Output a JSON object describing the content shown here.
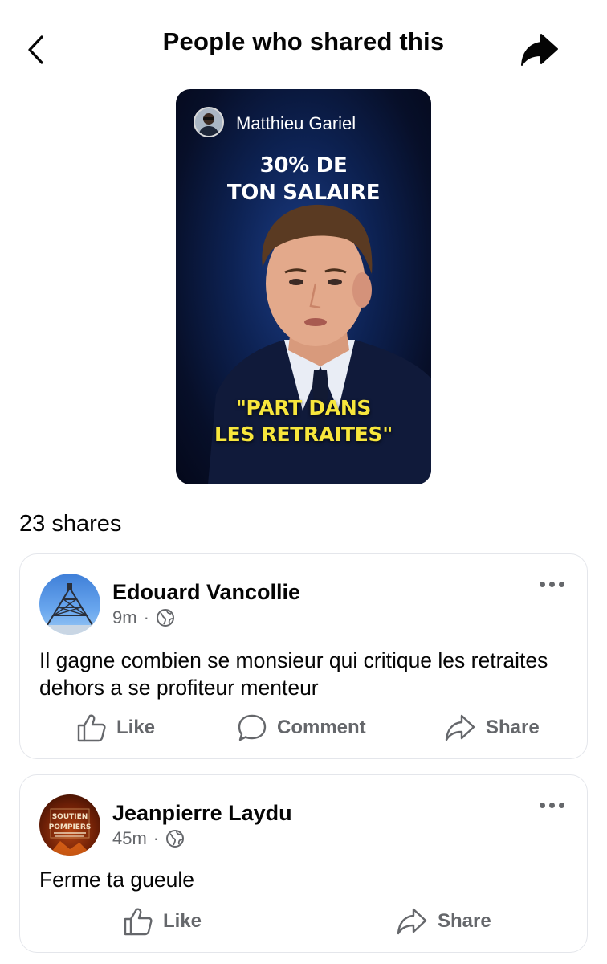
{
  "header": {
    "title": "People who shared this",
    "back_icon": "chevron-left-icon",
    "share_icon": "share-arrow-icon"
  },
  "video": {
    "author": "Matthieu Gariel",
    "headline_line1": "30% DE",
    "headline_line2": "TON SALAIRE",
    "quote_line1": "\"PART DANS",
    "quote_line2": "LES RETRAITES\"",
    "quote_color": "#f7e63c"
  },
  "shares": {
    "count_label": "23 shares"
  },
  "posts": [
    {
      "author": "Edouard Vancollie",
      "time": "9m",
      "privacy_icon": "globe-icon",
      "text": "Il gagne combien se monsieur qui critique les retraites dehors a se profiteur menteur",
      "actions": {
        "like": "Like",
        "comment": "Comment",
        "share": "Share"
      }
    },
    {
      "author": "Jeanpierre Laydu",
      "time": "45m",
      "privacy_icon": "globe-icon",
      "text": "Ferme ta gueule",
      "avatar_text_1": "SOUTIEN",
      "avatar_text_2": "POMPIERS",
      "actions": {
        "like": "Like",
        "share": "Share"
      }
    }
  ],
  "colors": {
    "text_primary": "#050505",
    "text_secondary": "#65676b",
    "card_border": "#e4e6eb"
  }
}
